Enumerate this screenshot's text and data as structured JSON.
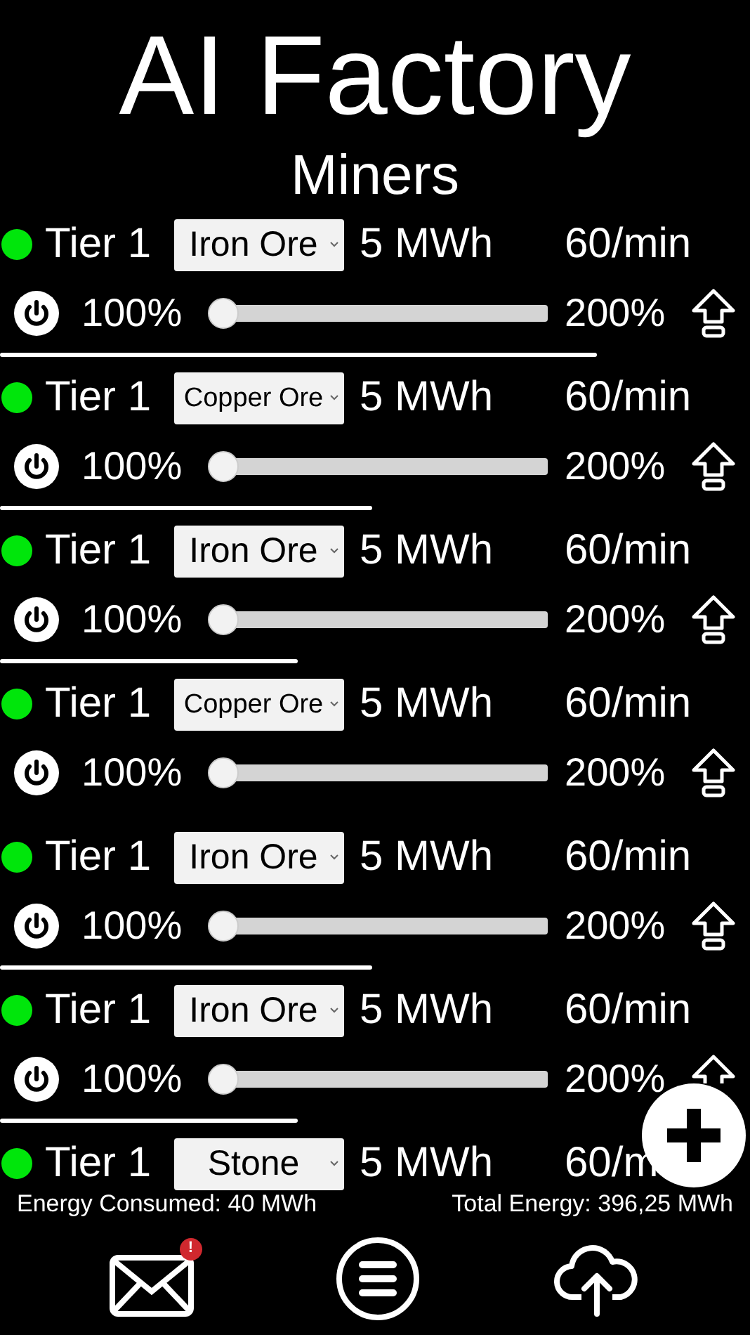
{
  "title": "AI Factory",
  "subtitle": "Miners",
  "miners": [
    {
      "tier": "Tier 1",
      "resource": "Iron Ore",
      "energy": "5 MWh",
      "rate": "60/min",
      "controls": {
        "min": "100%",
        "max": "200%",
        "level": 0
      }
    },
    {
      "tier": "Tier 1",
      "resource": "Copper Ore",
      "energy": "5 MWh",
      "rate": "60/min",
      "controls": {
        "min": "100%",
        "max": "200%",
        "level": 0
      }
    },
    {
      "tier": "Tier 1",
      "resource": "Iron Ore",
      "energy": "5 MWh",
      "rate": "60/min",
      "controls": {
        "min": "100%",
        "max": "200%",
        "level": 0
      }
    },
    {
      "tier": "Tier 1",
      "resource": "Copper Ore",
      "energy": "5 MWh",
      "rate": "60/min",
      "controls": {
        "min": "100%",
        "max": "200%",
        "level": 0
      }
    },
    {
      "tier": "Tier 1",
      "resource": "Iron Ore",
      "energy": "5 MWh",
      "rate": "60/min",
      "controls": {
        "min": "100%",
        "max": "200%",
        "level": 0
      }
    },
    {
      "tier": "Tier 1",
      "resource": "Iron Ore",
      "energy": "5 MWh",
      "rate": "60/min",
      "controls": {
        "min": "100%",
        "max": "200%",
        "level": 0
      }
    },
    {
      "tier": "Tier 1",
      "resource": "Stone",
      "energy": "5 MWh",
      "rate": "60/m"
    }
  ],
  "footer": {
    "energy_consumed": "Energy Consumed: 40 MWh",
    "total_energy": "Total Energy: 396,25 MWh"
  },
  "nav": {
    "mail_badge": "!"
  }
}
